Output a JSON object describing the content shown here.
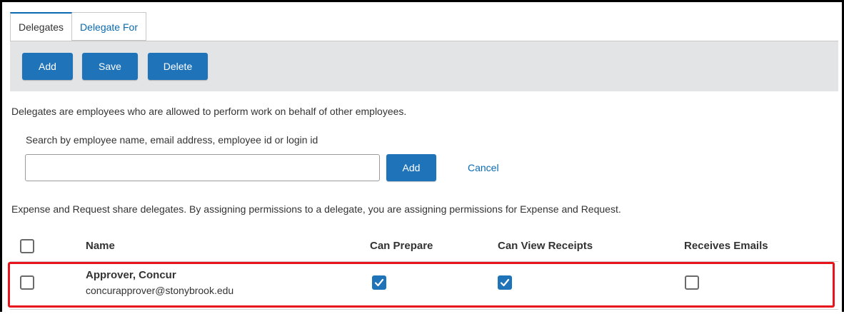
{
  "tabs": [
    {
      "label": "Delegates",
      "active": true
    },
    {
      "label": "Delegate For",
      "active": false
    }
  ],
  "toolbar": {
    "add_label": "Add",
    "save_label": "Save",
    "delete_label": "Delete"
  },
  "intro_text": "Delegates are employees who are allowed to perform work on behalf of other employees.",
  "search": {
    "label": "Search by employee name, email address, employee id or login id",
    "value": "",
    "add_label": "Add",
    "cancel_label": "Cancel"
  },
  "share_note": "Expense and Request share delegates. By assigning permissions to a delegate, you are assigning permissions for Expense and Request.",
  "table": {
    "columns": [
      "Name",
      "Can Prepare",
      "Can View Receipts",
      "Receives Emails"
    ],
    "rows": [
      {
        "selected": false,
        "name": "Approver, Concur",
        "email": "concurapprover@stonybrook.edu",
        "can_prepare": true,
        "can_view_receipts": true,
        "receives_emails": false
      }
    ]
  },
  "colors": {
    "accent": "#1f73b9",
    "link": "#0a6ab0",
    "highlight": "#e8141b",
    "toolbar_bg": "#e3e4e6"
  }
}
